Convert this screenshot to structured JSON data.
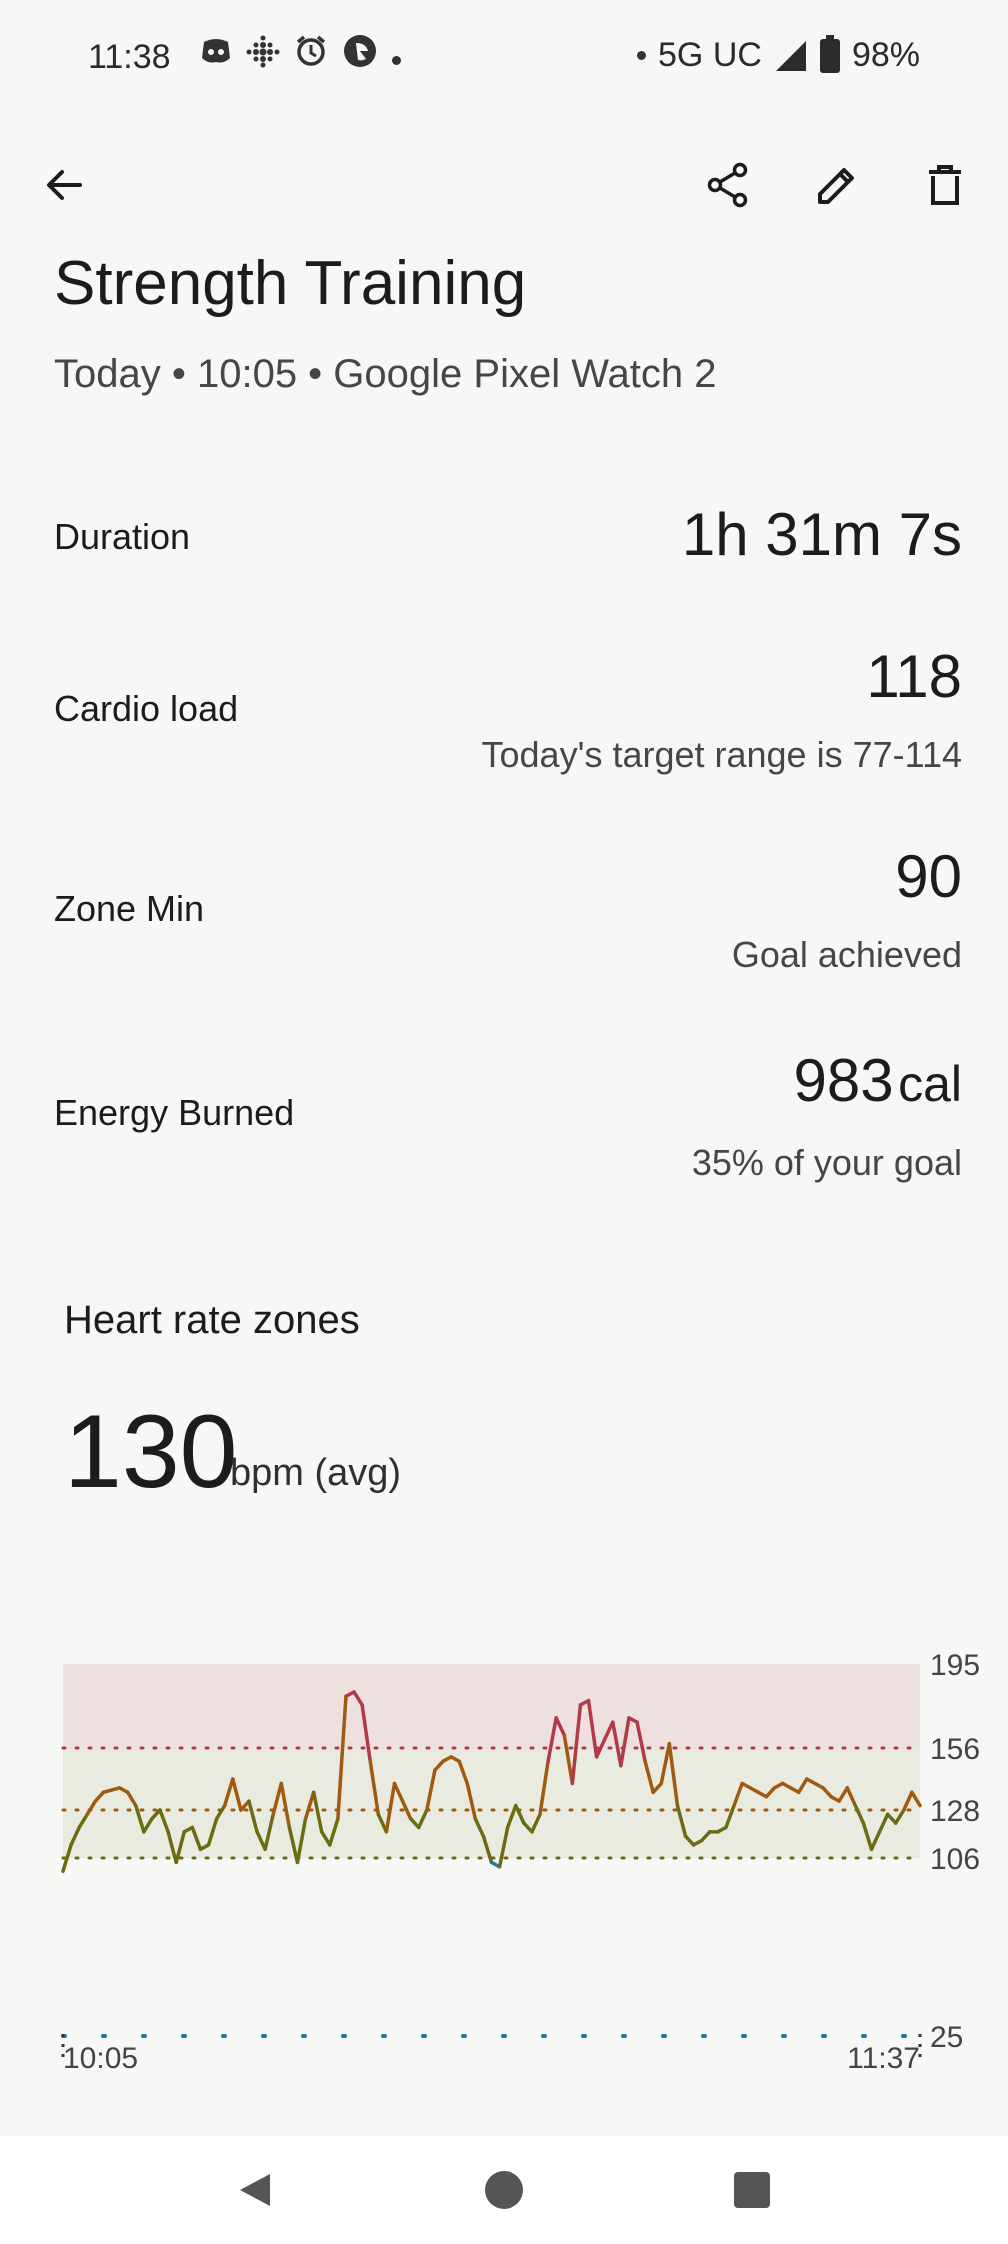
{
  "status_bar": {
    "time": "11:38",
    "network": "5G UC",
    "battery": "98%",
    "icons": [
      "discord-icon",
      "fitbit-icon",
      "alarm-icon",
      "app-icon",
      "dot-icon"
    ]
  },
  "app_bar": {
    "icons": [
      "back-arrow-icon",
      "share-icon",
      "edit-icon",
      "delete-icon"
    ]
  },
  "header": {
    "title": "Strength Training",
    "subtitle": "Today • 10:05 • Google Pixel Watch 2"
  },
  "stats": {
    "duration": {
      "label": "Duration",
      "value": "1h 31m 7s"
    },
    "cardio": {
      "label": "Cardio load",
      "value": "118",
      "sub": "Today's target range is 77-114"
    },
    "zone": {
      "label": "Zone Min",
      "value": "90",
      "sub": "Goal achieved"
    },
    "energy": {
      "label": "Energy Burned",
      "value": "983",
      "unit": "cal",
      "sub": "35% of your goal"
    }
  },
  "heart_rate": {
    "title": "Heart rate zones",
    "avg": "130",
    "unit": "bpm (avg)"
  },
  "chart_data": {
    "type": "line",
    "x_start": "10:05",
    "x_end": "11:37",
    "y_ticks": [
      "195",
      "156",
      "128",
      "106",
      "25"
    ],
    "zone_thresholds": [
      156,
      128,
      106
    ],
    "ylim": [
      25,
      195
    ],
    "colors": {
      "peak": "#b23a48",
      "cardio": "#a05a10",
      "fat_burn": "#6b6b12",
      "below": "#1f7aa0"
    },
    "series": [
      {
        "values": [
          100,
          112,
          120,
          126,
          132,
          136,
          137,
          138,
          136,
          130,
          118,
          124,
          128,
          118,
          104,
          118,
          120,
          110,
          112,
          124,
          130,
          142,
          128,
          132,
          118,
          110,
          126,
          140,
          120,
          104,
          124,
          136,
          118,
          112,
          124,
          180,
          182,
          176,
          150,
          126,
          118,
          140,
          132,
          124,
          120,
          128,
          146,
          150,
          152,
          150,
          140,
          124,
          116,
          104,
          102,
          120,
          130,
          122,
          118,
          126,
          150,
          170,
          162,
          140,
          176,
          178,
          152,
          160,
          168,
          148,
          170,
          168,
          150,
          136,
          140,
          158,
          130,
          116,
          112,
          114,
          118,
          118,
          120,
          130,
          140,
          138,
          136,
          134,
          138,
          140,
          138,
          136,
          142,
          140,
          138,
          134,
          132,
          138,
          130,
          122,
          110,
          118,
          126,
          122,
          128,
          136,
          130
        ]
      }
    ]
  },
  "nav_bar": {
    "icons": [
      "nav-back-icon",
      "nav-home-icon",
      "nav-recents-icon"
    ]
  }
}
